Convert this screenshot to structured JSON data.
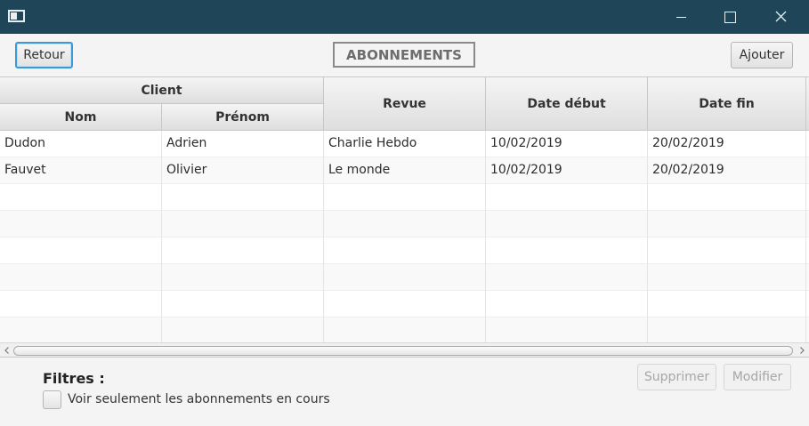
{
  "window": {
    "icons": {
      "app": "app-window-icon",
      "minimize": "minimize-icon",
      "maximize": "maximize-icon",
      "close": "close-icon"
    }
  },
  "toolbar": {
    "back_label": "Retour",
    "title": "ABONNEMENTS",
    "add_label": "Ajouter"
  },
  "table": {
    "group_header": "Client",
    "columns": [
      "Nom",
      "Prénom",
      "Revue",
      "Date début",
      "Date fin"
    ],
    "rows": [
      [
        "Dudon",
        "Adrien",
        "Charlie Hebdo",
        "10/02/2019",
        "20/02/2019"
      ],
      [
        "Fauvet",
        "Olivier",
        "Le monde",
        "10/02/2019",
        "20/02/2019"
      ]
    ],
    "empty_rows": 6
  },
  "actions": {
    "delete_label": "Supprimer",
    "edit_label": "Modifier"
  },
  "filters": {
    "title": "Filtres :",
    "current_only_label": "Voir seulement les abonnements en cours",
    "current_only_checked": false
  },
  "colors": {
    "titlebar": "#1e4558",
    "focus_accent": "#3a9ad9"
  }
}
